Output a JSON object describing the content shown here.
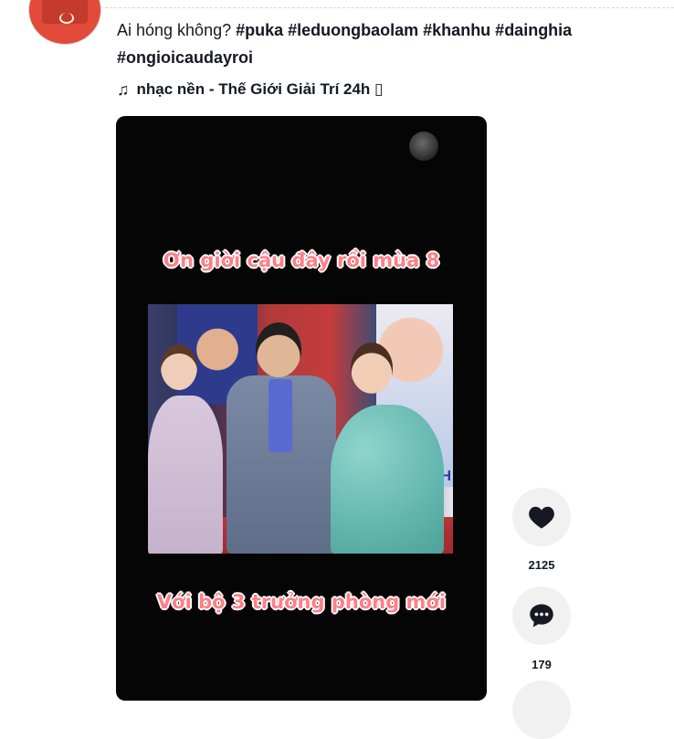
{
  "post": {
    "caption_text": "Ai hóng không?",
    "hashtags_line1": "#puka #leduongbaolam #khanhu #dainghia",
    "hashtags_line2": "#ongioicaudayroi",
    "music": "nhạc nền - Thế Giới Giải Trí 24h ▯"
  },
  "video": {
    "overlay_top": "Ơn giời cậu đây rồi mùa 8",
    "overlay_bottom": "Với bộ 3 trưởng phòng mới",
    "poster_text": "NH"
  },
  "actions": {
    "likes": "2125",
    "comments": "179"
  },
  "icons": {
    "music": "music-note-icon",
    "like": "heart-icon",
    "comment": "comment-bubble-icon"
  },
  "colors": {
    "overlay_text": "#ff7f86",
    "action_bg": "#f1f1f2",
    "text": "#161823"
  }
}
